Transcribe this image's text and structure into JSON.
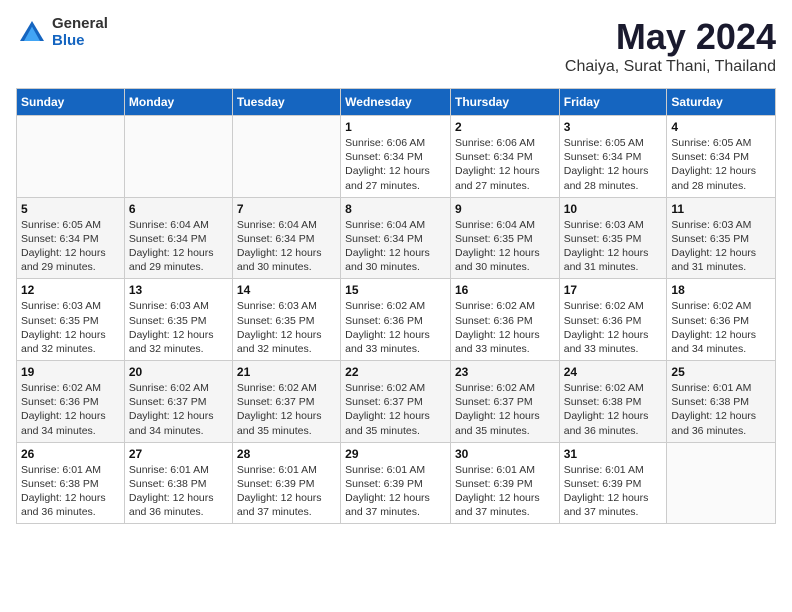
{
  "header": {
    "logo_general": "General",
    "logo_blue": "Blue",
    "main_title": "May 2024",
    "subtitle": "Chaiya, Surat Thani, Thailand"
  },
  "calendar": {
    "days_of_week": [
      "Sunday",
      "Monday",
      "Tuesday",
      "Wednesday",
      "Thursday",
      "Friday",
      "Saturday"
    ],
    "weeks": [
      [
        {
          "day": "",
          "info": ""
        },
        {
          "day": "",
          "info": ""
        },
        {
          "day": "",
          "info": ""
        },
        {
          "day": "1",
          "info": "Sunrise: 6:06 AM\nSunset: 6:34 PM\nDaylight: 12 hours\nand 27 minutes."
        },
        {
          "day": "2",
          "info": "Sunrise: 6:06 AM\nSunset: 6:34 PM\nDaylight: 12 hours\nand 27 minutes."
        },
        {
          "day": "3",
          "info": "Sunrise: 6:05 AM\nSunset: 6:34 PM\nDaylight: 12 hours\nand 28 minutes."
        },
        {
          "day": "4",
          "info": "Sunrise: 6:05 AM\nSunset: 6:34 PM\nDaylight: 12 hours\nand 28 minutes."
        }
      ],
      [
        {
          "day": "5",
          "info": "Sunrise: 6:05 AM\nSunset: 6:34 PM\nDaylight: 12 hours\nand 29 minutes."
        },
        {
          "day": "6",
          "info": "Sunrise: 6:04 AM\nSunset: 6:34 PM\nDaylight: 12 hours\nand 29 minutes."
        },
        {
          "day": "7",
          "info": "Sunrise: 6:04 AM\nSunset: 6:34 PM\nDaylight: 12 hours\nand 30 minutes."
        },
        {
          "day": "8",
          "info": "Sunrise: 6:04 AM\nSunset: 6:34 PM\nDaylight: 12 hours\nand 30 minutes."
        },
        {
          "day": "9",
          "info": "Sunrise: 6:04 AM\nSunset: 6:35 PM\nDaylight: 12 hours\nand 30 minutes."
        },
        {
          "day": "10",
          "info": "Sunrise: 6:03 AM\nSunset: 6:35 PM\nDaylight: 12 hours\nand 31 minutes."
        },
        {
          "day": "11",
          "info": "Sunrise: 6:03 AM\nSunset: 6:35 PM\nDaylight: 12 hours\nand 31 minutes."
        }
      ],
      [
        {
          "day": "12",
          "info": "Sunrise: 6:03 AM\nSunset: 6:35 PM\nDaylight: 12 hours\nand 32 minutes."
        },
        {
          "day": "13",
          "info": "Sunrise: 6:03 AM\nSunset: 6:35 PM\nDaylight: 12 hours\nand 32 minutes."
        },
        {
          "day": "14",
          "info": "Sunrise: 6:03 AM\nSunset: 6:35 PM\nDaylight: 12 hours\nand 32 minutes."
        },
        {
          "day": "15",
          "info": "Sunrise: 6:02 AM\nSunset: 6:36 PM\nDaylight: 12 hours\nand 33 minutes."
        },
        {
          "day": "16",
          "info": "Sunrise: 6:02 AM\nSunset: 6:36 PM\nDaylight: 12 hours\nand 33 minutes."
        },
        {
          "day": "17",
          "info": "Sunrise: 6:02 AM\nSunset: 6:36 PM\nDaylight: 12 hours\nand 33 minutes."
        },
        {
          "day": "18",
          "info": "Sunrise: 6:02 AM\nSunset: 6:36 PM\nDaylight: 12 hours\nand 34 minutes."
        }
      ],
      [
        {
          "day": "19",
          "info": "Sunrise: 6:02 AM\nSunset: 6:36 PM\nDaylight: 12 hours\nand 34 minutes."
        },
        {
          "day": "20",
          "info": "Sunrise: 6:02 AM\nSunset: 6:37 PM\nDaylight: 12 hours\nand 34 minutes."
        },
        {
          "day": "21",
          "info": "Sunrise: 6:02 AM\nSunset: 6:37 PM\nDaylight: 12 hours\nand 35 minutes."
        },
        {
          "day": "22",
          "info": "Sunrise: 6:02 AM\nSunset: 6:37 PM\nDaylight: 12 hours\nand 35 minutes."
        },
        {
          "day": "23",
          "info": "Sunrise: 6:02 AM\nSunset: 6:37 PM\nDaylight: 12 hours\nand 35 minutes."
        },
        {
          "day": "24",
          "info": "Sunrise: 6:02 AM\nSunset: 6:38 PM\nDaylight: 12 hours\nand 36 minutes."
        },
        {
          "day": "25",
          "info": "Sunrise: 6:01 AM\nSunset: 6:38 PM\nDaylight: 12 hours\nand 36 minutes."
        }
      ],
      [
        {
          "day": "26",
          "info": "Sunrise: 6:01 AM\nSunset: 6:38 PM\nDaylight: 12 hours\nand 36 minutes."
        },
        {
          "day": "27",
          "info": "Sunrise: 6:01 AM\nSunset: 6:38 PM\nDaylight: 12 hours\nand 36 minutes."
        },
        {
          "day": "28",
          "info": "Sunrise: 6:01 AM\nSunset: 6:39 PM\nDaylight: 12 hours\nand 37 minutes."
        },
        {
          "day": "29",
          "info": "Sunrise: 6:01 AM\nSunset: 6:39 PM\nDaylight: 12 hours\nand 37 minutes."
        },
        {
          "day": "30",
          "info": "Sunrise: 6:01 AM\nSunset: 6:39 PM\nDaylight: 12 hours\nand 37 minutes."
        },
        {
          "day": "31",
          "info": "Sunrise: 6:01 AM\nSunset: 6:39 PM\nDaylight: 12 hours\nand 37 minutes."
        },
        {
          "day": "",
          "info": ""
        }
      ]
    ]
  }
}
